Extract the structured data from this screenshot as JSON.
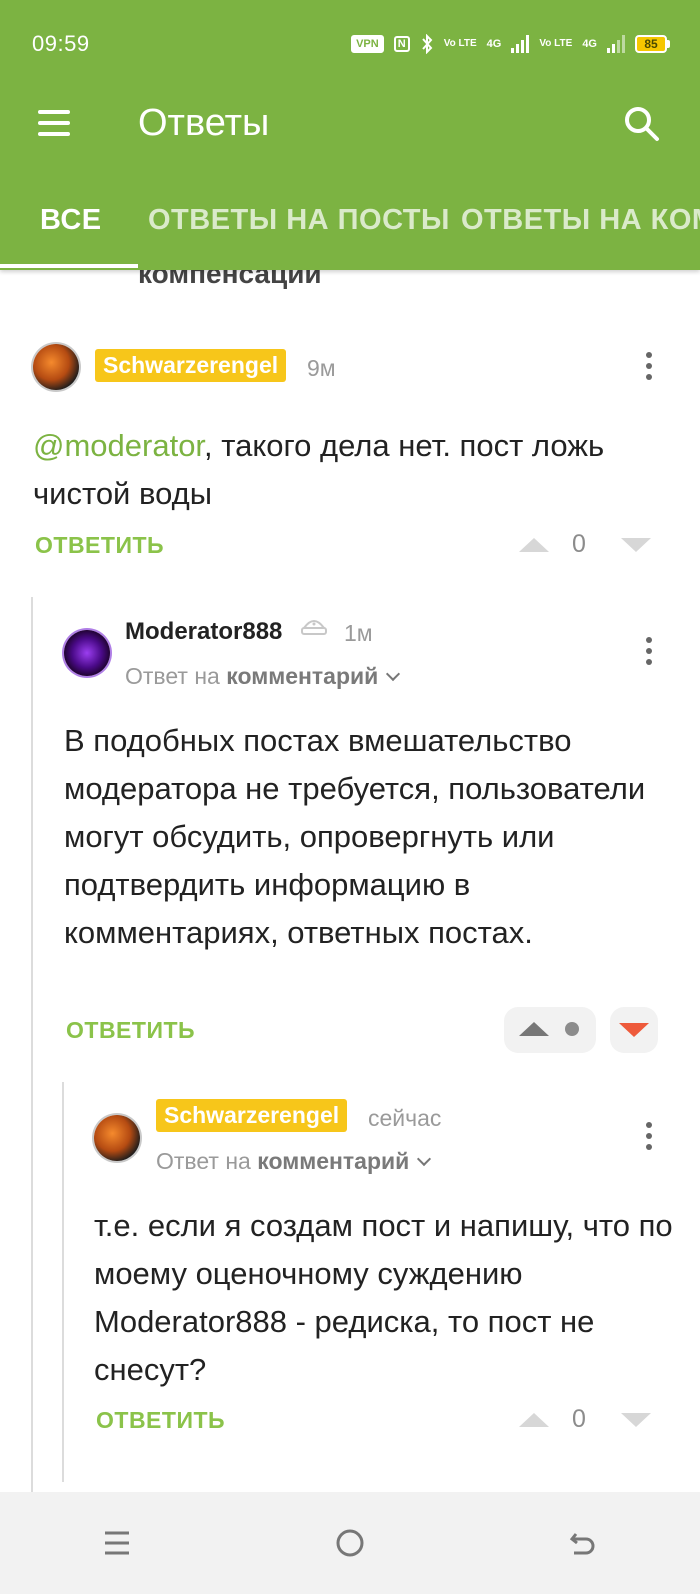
{
  "status_bar": {
    "time": "09:59",
    "vpn": "VPN",
    "nfc": "N",
    "lte1": "Vo LTE",
    "net1": "4G",
    "lte2": "Vo LTE",
    "net2": "4G",
    "battery": "85"
  },
  "toolbar": {
    "title": "Ответы"
  },
  "tabs": [
    {
      "label": "ВСЕ",
      "active": true
    },
    {
      "label": "ОТВЕТЫ НА ПОСТЫ",
      "active": false
    },
    {
      "label": "ОТВЕТЫ НА КОММЕНТАРИИ",
      "active": false
    }
  ],
  "partial_post_tail": "компенсации",
  "comments": [
    {
      "author": "Schwarzerengel",
      "time": "9м",
      "mention": "@moderator",
      "text": ", такого дела нет. пост ложь чистой воды",
      "reply_label": "ОТВЕТИТЬ",
      "score": "0"
    },
    {
      "author": "Moderator888",
      "time": "1м",
      "reply_to_prefix": "Ответ на",
      "reply_to_target": "комментарий",
      "text": "В подобных постах вмешательство модератора не требуется, пользователи могут обсудить, опровергнуть или подтвердить информацию в комментариях, ответных постах.",
      "reply_label": "ОТВЕТИТЬ"
    },
    {
      "author": "Schwarzerengel",
      "time": "сейчас",
      "reply_to_prefix": "Ответ на",
      "reply_to_target": "комментарий",
      "text": "т.е. если я создам пост и напишу, что по моему оценочному суждению Moderator888 - редиска, то пост не снесут?",
      "reply_label": "ОТВЕТИТЬ",
      "score": "0"
    }
  ],
  "colors": {
    "brand_green": "#7cb342",
    "badge_yellow": "#f7c61a",
    "downvote_red": "#ee5a3b"
  },
  "icons": {
    "menu": "hamburger-icon",
    "search": "search-icon",
    "mod_badge": "moderator-badge-icon",
    "nav_menu": "nav-menu-icon",
    "nav_home": "nav-home-icon",
    "nav_back": "nav-back-icon"
  }
}
